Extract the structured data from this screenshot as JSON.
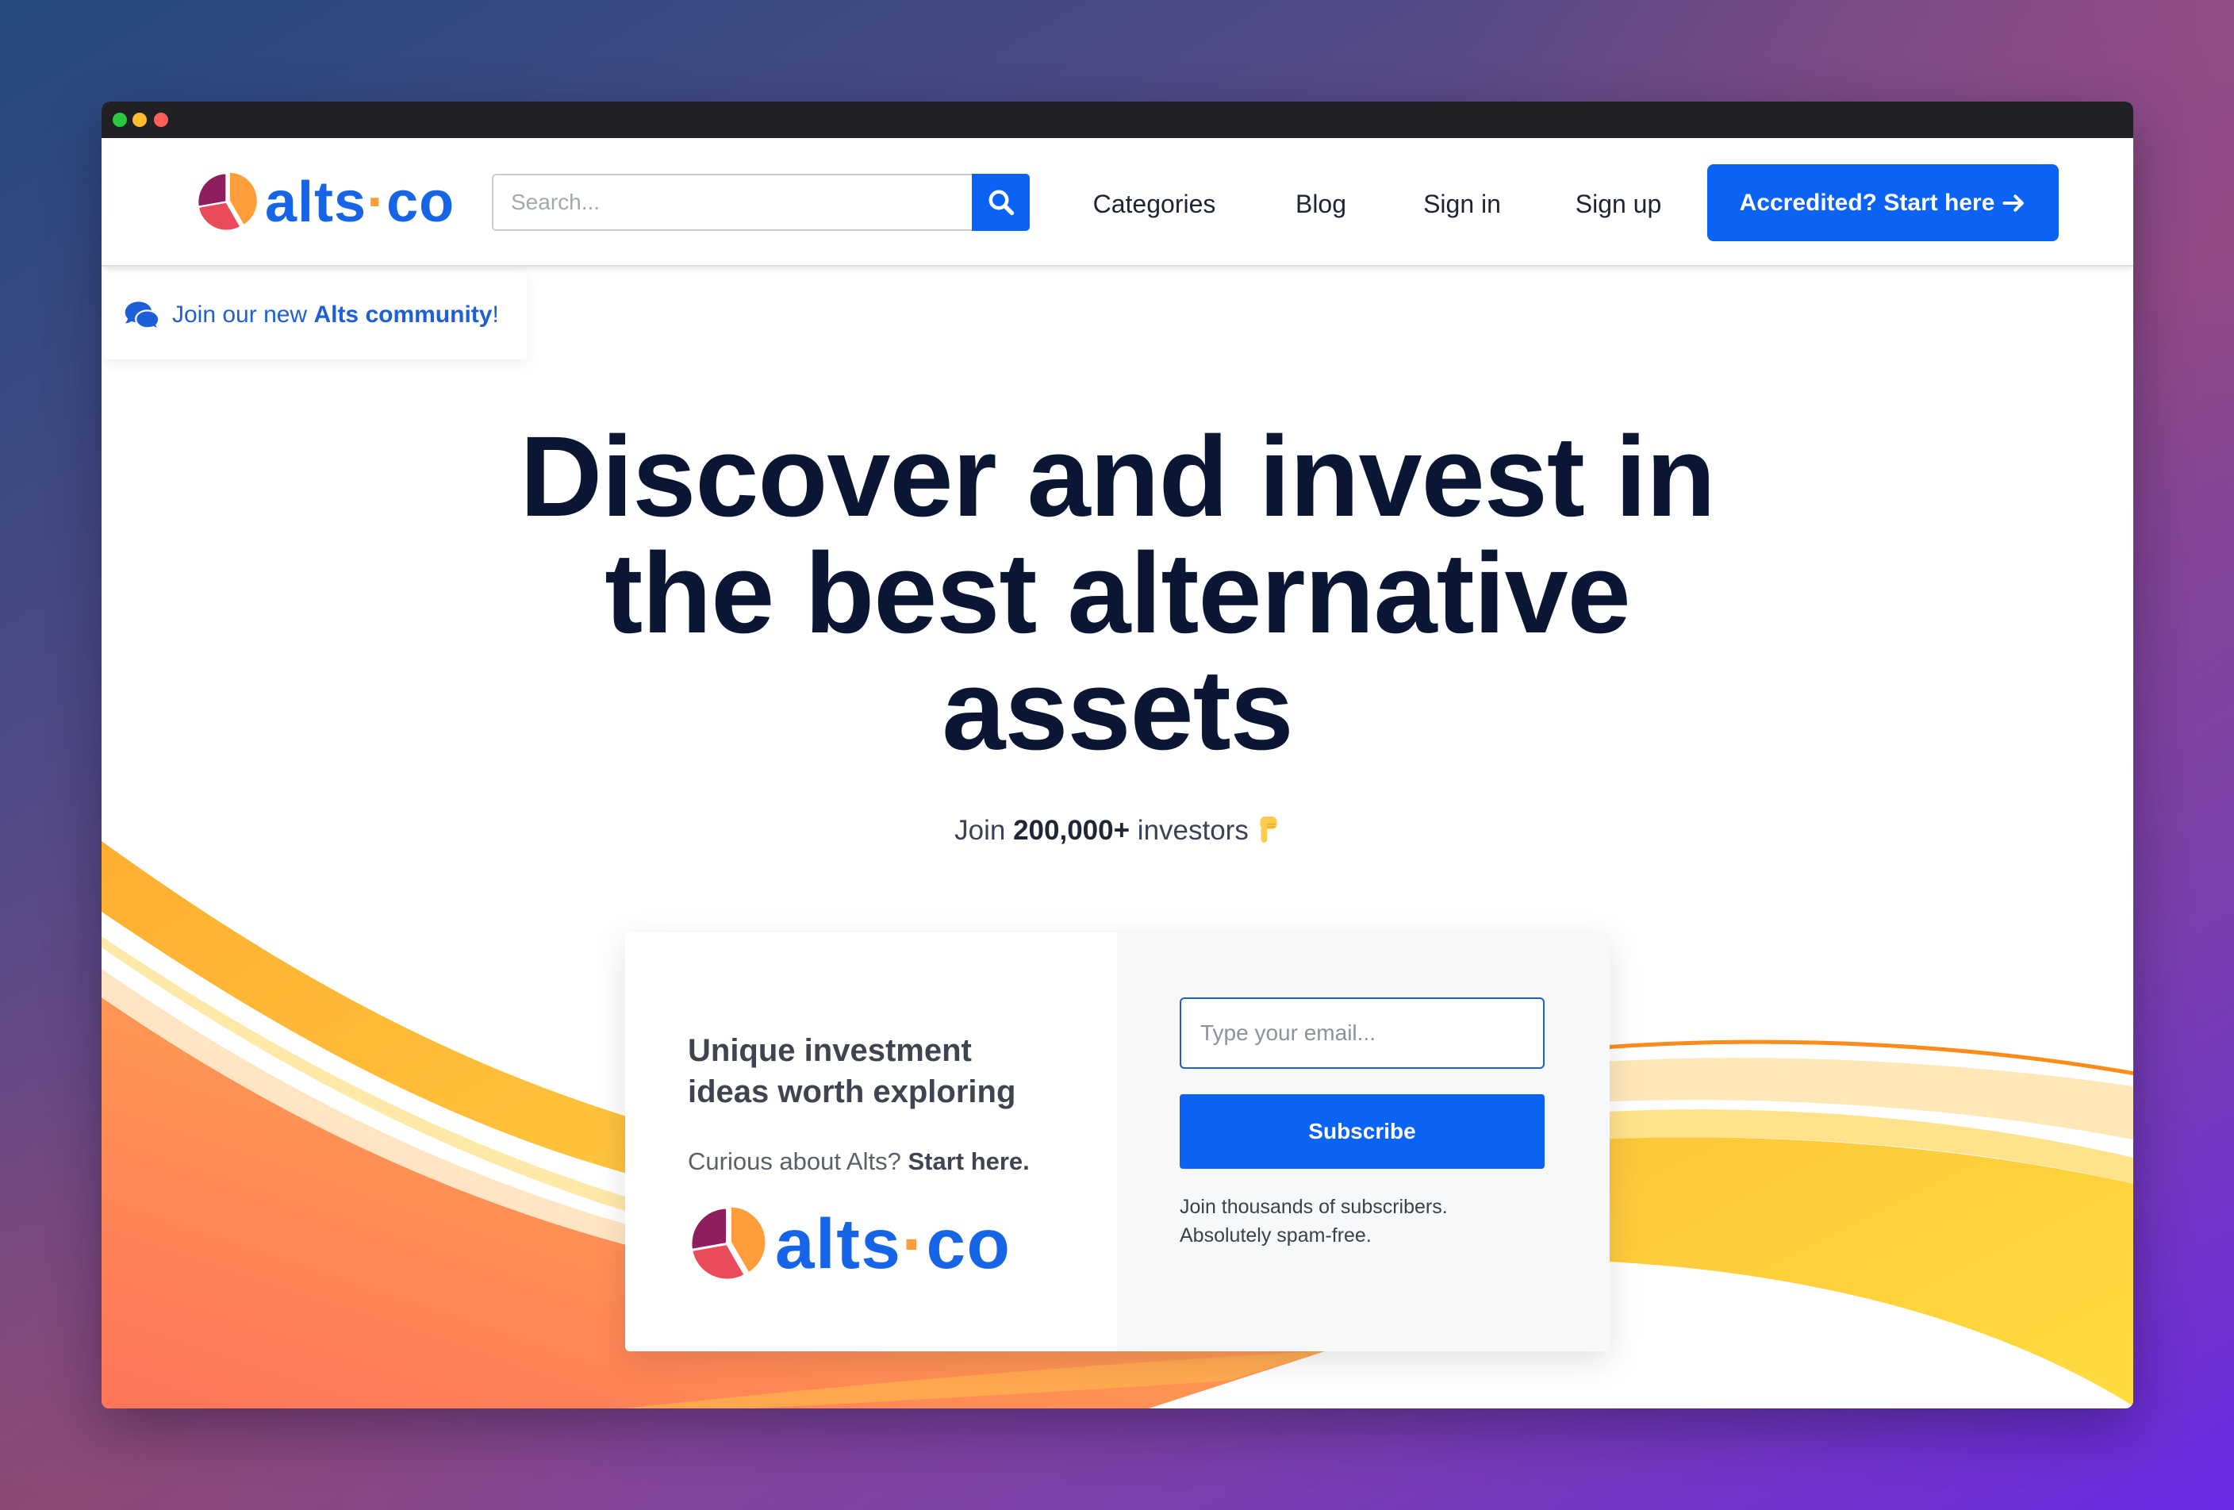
{
  "colors": {
    "brand_blue": "#0b63f6",
    "logo_blue": "#1565e6",
    "logo_orange": "#ff9d3b",
    "heading_navy": "#0a1633",
    "link_blue": "#1c5fd8",
    "titlebar": "#202124"
  },
  "window_controls": {
    "dot_colors": [
      "#28c840",
      "#febc2e",
      "#ff5f57"
    ]
  },
  "header": {
    "logo": {
      "part1": "alts",
      "separator": "·",
      "part2": "co",
      "icon": "pie-chart-logo-icon"
    },
    "search": {
      "value": "",
      "placeholder": "Search...",
      "button_icon": "search-icon"
    },
    "nav": [
      {
        "label": "Categories"
      },
      {
        "label": "Blog"
      },
      {
        "label": "Sign in"
      },
      {
        "label": "Sign up"
      }
    ],
    "cta": {
      "label": "Accredited? Start here",
      "icon": "arrow-right-icon"
    }
  },
  "community_banner": {
    "icon": "chat-bubbles-icon",
    "prefix": "Join our new ",
    "link": "Alts community",
    "suffix": "!"
  },
  "hero": {
    "title_lines": [
      "Discover and invest in",
      "the best alternative",
      "assets"
    ],
    "subtitle": {
      "prefix": "Join ",
      "count": "200,000+",
      "suffix": " investors",
      "icon": "pointing-down-hand-icon"
    }
  },
  "signup_card": {
    "heading_lines": [
      "Unique investment",
      "ideas worth exploring"
    ],
    "prompt": {
      "prefix": "Curious about Alts? ",
      "link": "Start here."
    },
    "logo": {
      "part1": "alts",
      "separator": "·",
      "part2": "co",
      "icon": "pie-chart-logo-icon"
    },
    "email": {
      "value": "",
      "placeholder": "Type your email..."
    },
    "subscribe_label": "Subscribe",
    "note_lines": [
      "Join thousands of subscribers.",
      "Absolutely spam-free."
    ]
  }
}
